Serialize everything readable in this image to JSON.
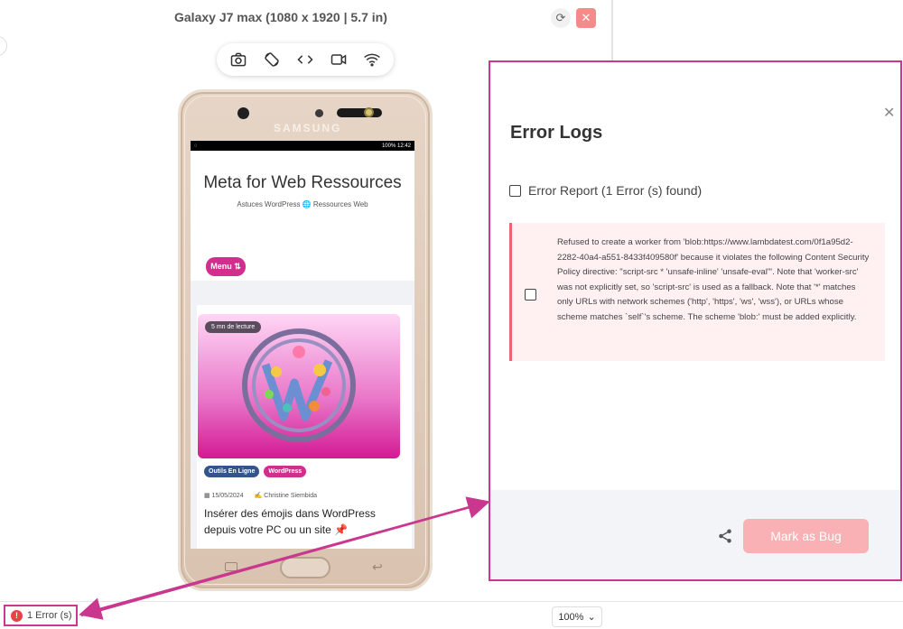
{
  "device": {
    "title": "Galaxy J7 max (1080 x 1920 | 5.7 in)",
    "brand": "SAMSUNG"
  },
  "toolbar": {
    "icons": [
      "camera-icon",
      "rotate-icon",
      "code-icon",
      "video-icon",
      "wifi-icon"
    ]
  },
  "phone_screen": {
    "status_right": "100% 12:42",
    "site_title": "Meta for Web Ressources",
    "site_subtitle": "Astuces WordPress 🌐 Ressources Web",
    "menu_label": "Menu ⇅",
    "read_badge": "5 mn de lecture",
    "tags": [
      "Outils En Ligne",
      "WordPress"
    ],
    "date": "15/05/2024",
    "author": "Christine Siembida",
    "post_title": "Insérer des émojis dans WordPress depuis votre PC ou un site 📌"
  },
  "error_panel": {
    "title": "Error Logs",
    "report_label": "Error Report (1 Error (s) found)",
    "error_message": "Refused to create a worker from 'blob:https://www.lambdatest.com/0f1a95d2-2282-40a4-a551-8433f409580f' because it violates the following Content Security Policy directive: \"script-src * 'unsafe-inline' 'unsafe-eval'\". Note that 'worker-src' was not explicitly set, so 'script-src' is used as a fallback. Note that '*' matches only URLs with network schemes ('http', 'https', 'ws', 'wss'), or URLs whose scheme matches `self`'s scheme. The scheme 'blob:' must be added explicitly.",
    "mark_bug_label": "Mark as Bug"
  },
  "bottom_bar": {
    "error_count": "1 Error (s)",
    "zoom": "100%"
  },
  "colors": {
    "highlight": "#c9378f",
    "error_red": "#e64545",
    "bug_button": "#f9b1b6",
    "menu_pink": "#d12f8d"
  }
}
